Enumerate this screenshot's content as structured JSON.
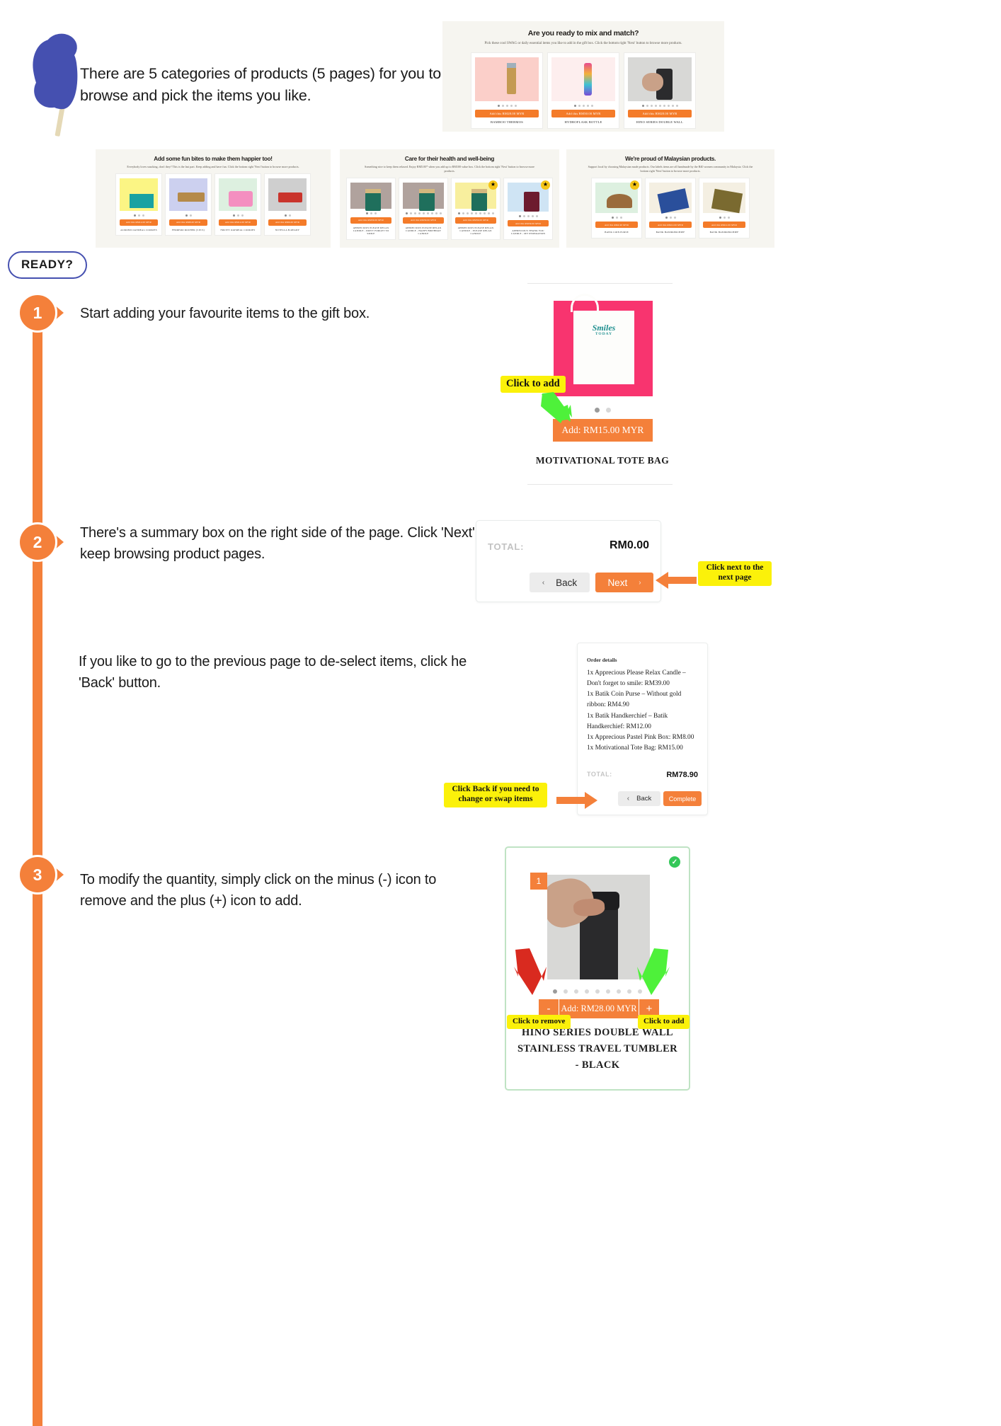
{
  "intro": {
    "text": "There are 5 categories of products (5 pages) for you to browse and pick the items you like."
  },
  "ready_badge": "READY?",
  "mockups": {
    "swag": {
      "title": "Are you ready to mix and match?",
      "subtitle": "Pick these cool SWAG or daily essential items you like to add in the gift box. Click the bottom right 'Next' button to browse more products.",
      "cards": [
        {
          "name": "BAMBOO THERMOS",
          "button": "Add this RM28.00 MYR",
          "bg": "#fbcfc9",
          "dots": 5,
          "active": 0
        },
        {
          "name": "HYDROFLASK BOTTLE",
          "button": "Add this RM50.00 MYR",
          "bg": "#fdeeee",
          "dots": 5,
          "active": 0
        },
        {
          "name": "HINO SERIES DOUBLE WALL",
          "button": "Add this RM28.00 MYR",
          "bg": "#d8d8d6",
          "dots": 9,
          "active": 0
        }
      ]
    },
    "snacks": {
      "title": "Add some fun bites to make them happier too!",
      "subtitle": "Everybody loves snacking, don't they? This is the last part. Keep adding and have fun. Click the bottom right 'Next' button to browse more products.",
      "cards": [
        {
          "name": "ALMOND OATMEAL COOKIES",
          "button": "Add this RM12.00 MYR",
          "bg": "#fbf584",
          "dots": 3,
          "active": 0
        },
        {
          "name": "FERRERO ROCHER (3 PCS)",
          "button": "Add this RM8.00 MYR",
          "bg": "#ccd0ef",
          "dots": 2,
          "active": 0
        },
        {
          "name": "FRUITY OATMEAL COOKIES",
          "button": "Add this RM12.00 MYR",
          "bg": "#f9c9e0",
          "dots": 3,
          "active": 0
        },
        {
          "name": "NUTELLA B-READY",
          "button": "Add this RM6.00 MYR",
          "bg": "#cfcfcf",
          "dots": 2,
          "active": 0
        }
      ]
    },
    "health": {
      "title": "Care for their health and well-being",
      "subtitle": "Something nice to keep them relaxed. Enjoy RM5.00* when you add up to RM100 value box. Click the bottom right 'Next' button to browse more products.",
      "cards": [
        {
          "name": "APPRECIOUS PLEASE RELAX CANDLE - DON'T FORGET TO SMILE",
          "button": "Add this RM39.00 MYR",
          "bg": "#b0a29d",
          "dots": 3,
          "active": 0,
          "badge": false
        },
        {
          "name": "APPRECIOUS PLEASE RELAX CANDLE - HAPPY BIRTHDAY CANDLE",
          "button": "Add this RM39.00 MYR",
          "bg": "#b0a29d",
          "dots": 9,
          "active": 0,
          "badge": false
        },
        {
          "name": "APPRECIOUS PLEASE RELAX CANDLE - PLEASE RELAX CANDLE",
          "button": "Add this RM39.00 MYR",
          "bg": "#f8ef9e",
          "dots": 9,
          "active": 0,
          "badge": true
        },
        {
          "name": "APPRECIOUS THANK YOU CANDLE - MY INSPIRATION",
          "button": "Add this RM39.00 MYR",
          "bg": "#cfe4f4",
          "dots": 5,
          "active": 0,
          "badge": true
        }
      ]
    },
    "malaysian": {
      "title": "We're proud of Malaysian products.",
      "subtitle": "Support local by choosing Malaysian made products. Our labels items are all handmade by the B40 women community in Malaysia. Click the bottom right 'Next' button to browse more products.",
      "cards": [
        {
          "name": "BATIK COIN PURSE",
          "button": "Add this RM4.90 MYR",
          "bg": "#ddf0e0",
          "dots": 3,
          "active": 0,
          "badge": true
        },
        {
          "name": "BATIK HANDKERCHIEF",
          "button": "Add this RM12.00 MYR",
          "bg": "#f4efe2",
          "dots": 3,
          "active": 0,
          "badge": false
        },
        {
          "name": "BATIK HANDKERCHIEF",
          "button": "Add this RM12.00 MYR",
          "bg": "#f4efe2",
          "dots": 3,
          "active": 0,
          "badge": false
        }
      ]
    }
  },
  "steps": [
    {
      "number": "1",
      "text": "Start adding your favourite items to the gift box."
    },
    {
      "number": "2",
      "text": "There's a summary box on the right side of the page. Click 'Next' to keep browsing product pages.",
      "text_b": "If you like to go to the previous page to de-select items, click he 'Back' button."
    },
    {
      "number": "3",
      "text": "To modify the quantity, simply click on the minus (-) icon to remove and the plus (+) icon to add."
    }
  ],
  "tote_product": {
    "art_line": "Smiles",
    "art_sub": "TODAY",
    "add_button": "Add: RM15.00 MYR",
    "name": "MOTIVATIONAL TOTE BAG",
    "dots": 2,
    "active_dot": 0,
    "callout": "Click to add"
  },
  "total_box": {
    "label": "TOTAL:",
    "amount": "RM0.00",
    "back_label": "Back",
    "next_label": "Next",
    "back_chevron": "‹",
    "next_chevron": "›",
    "callout": "Click next  to the next page"
  },
  "order_box": {
    "title": "Order details",
    "items": [
      "1x Apprecious Please Relax Candle – Don't forget to smile: RM39.00",
      "1x Batik Coin Purse – Without gold ribbon: RM4.90",
      "1x Batik Handkerchief – Batik Handkerchief: RM12.00",
      "1x Apprecious Pastel Pink Box: RM8.00",
      "1x Motivational Tote Bag: RM15.00"
    ],
    "total_label": "TOTAL:",
    "total_amount": "RM78.90",
    "back_label": "Back",
    "complete_label": "Complete",
    "back_chevron": "‹",
    "callout": "Click Back if you need to change or swap items"
  },
  "tumbler_product": {
    "quantity": "1",
    "minus_label": "-",
    "plus_label": "+",
    "add_button": "Add: RM28.00 MYR",
    "name": "HINO SERIES DOUBLE WALL STAINLESS TRAVEL TUMBLER - BLACK",
    "dots": 9,
    "active_dot": 0,
    "check_glyph": "✓",
    "callout_remove": "Click to remove",
    "callout_add": "Click to add"
  },
  "colors": {
    "orange": "#f4803a",
    "blue": "#4550b0",
    "yellow_highlight": "#fbf10a",
    "green_arrow": "#4ef13a",
    "red_arrow": "#d92a1f",
    "pink": "#f8346f"
  }
}
